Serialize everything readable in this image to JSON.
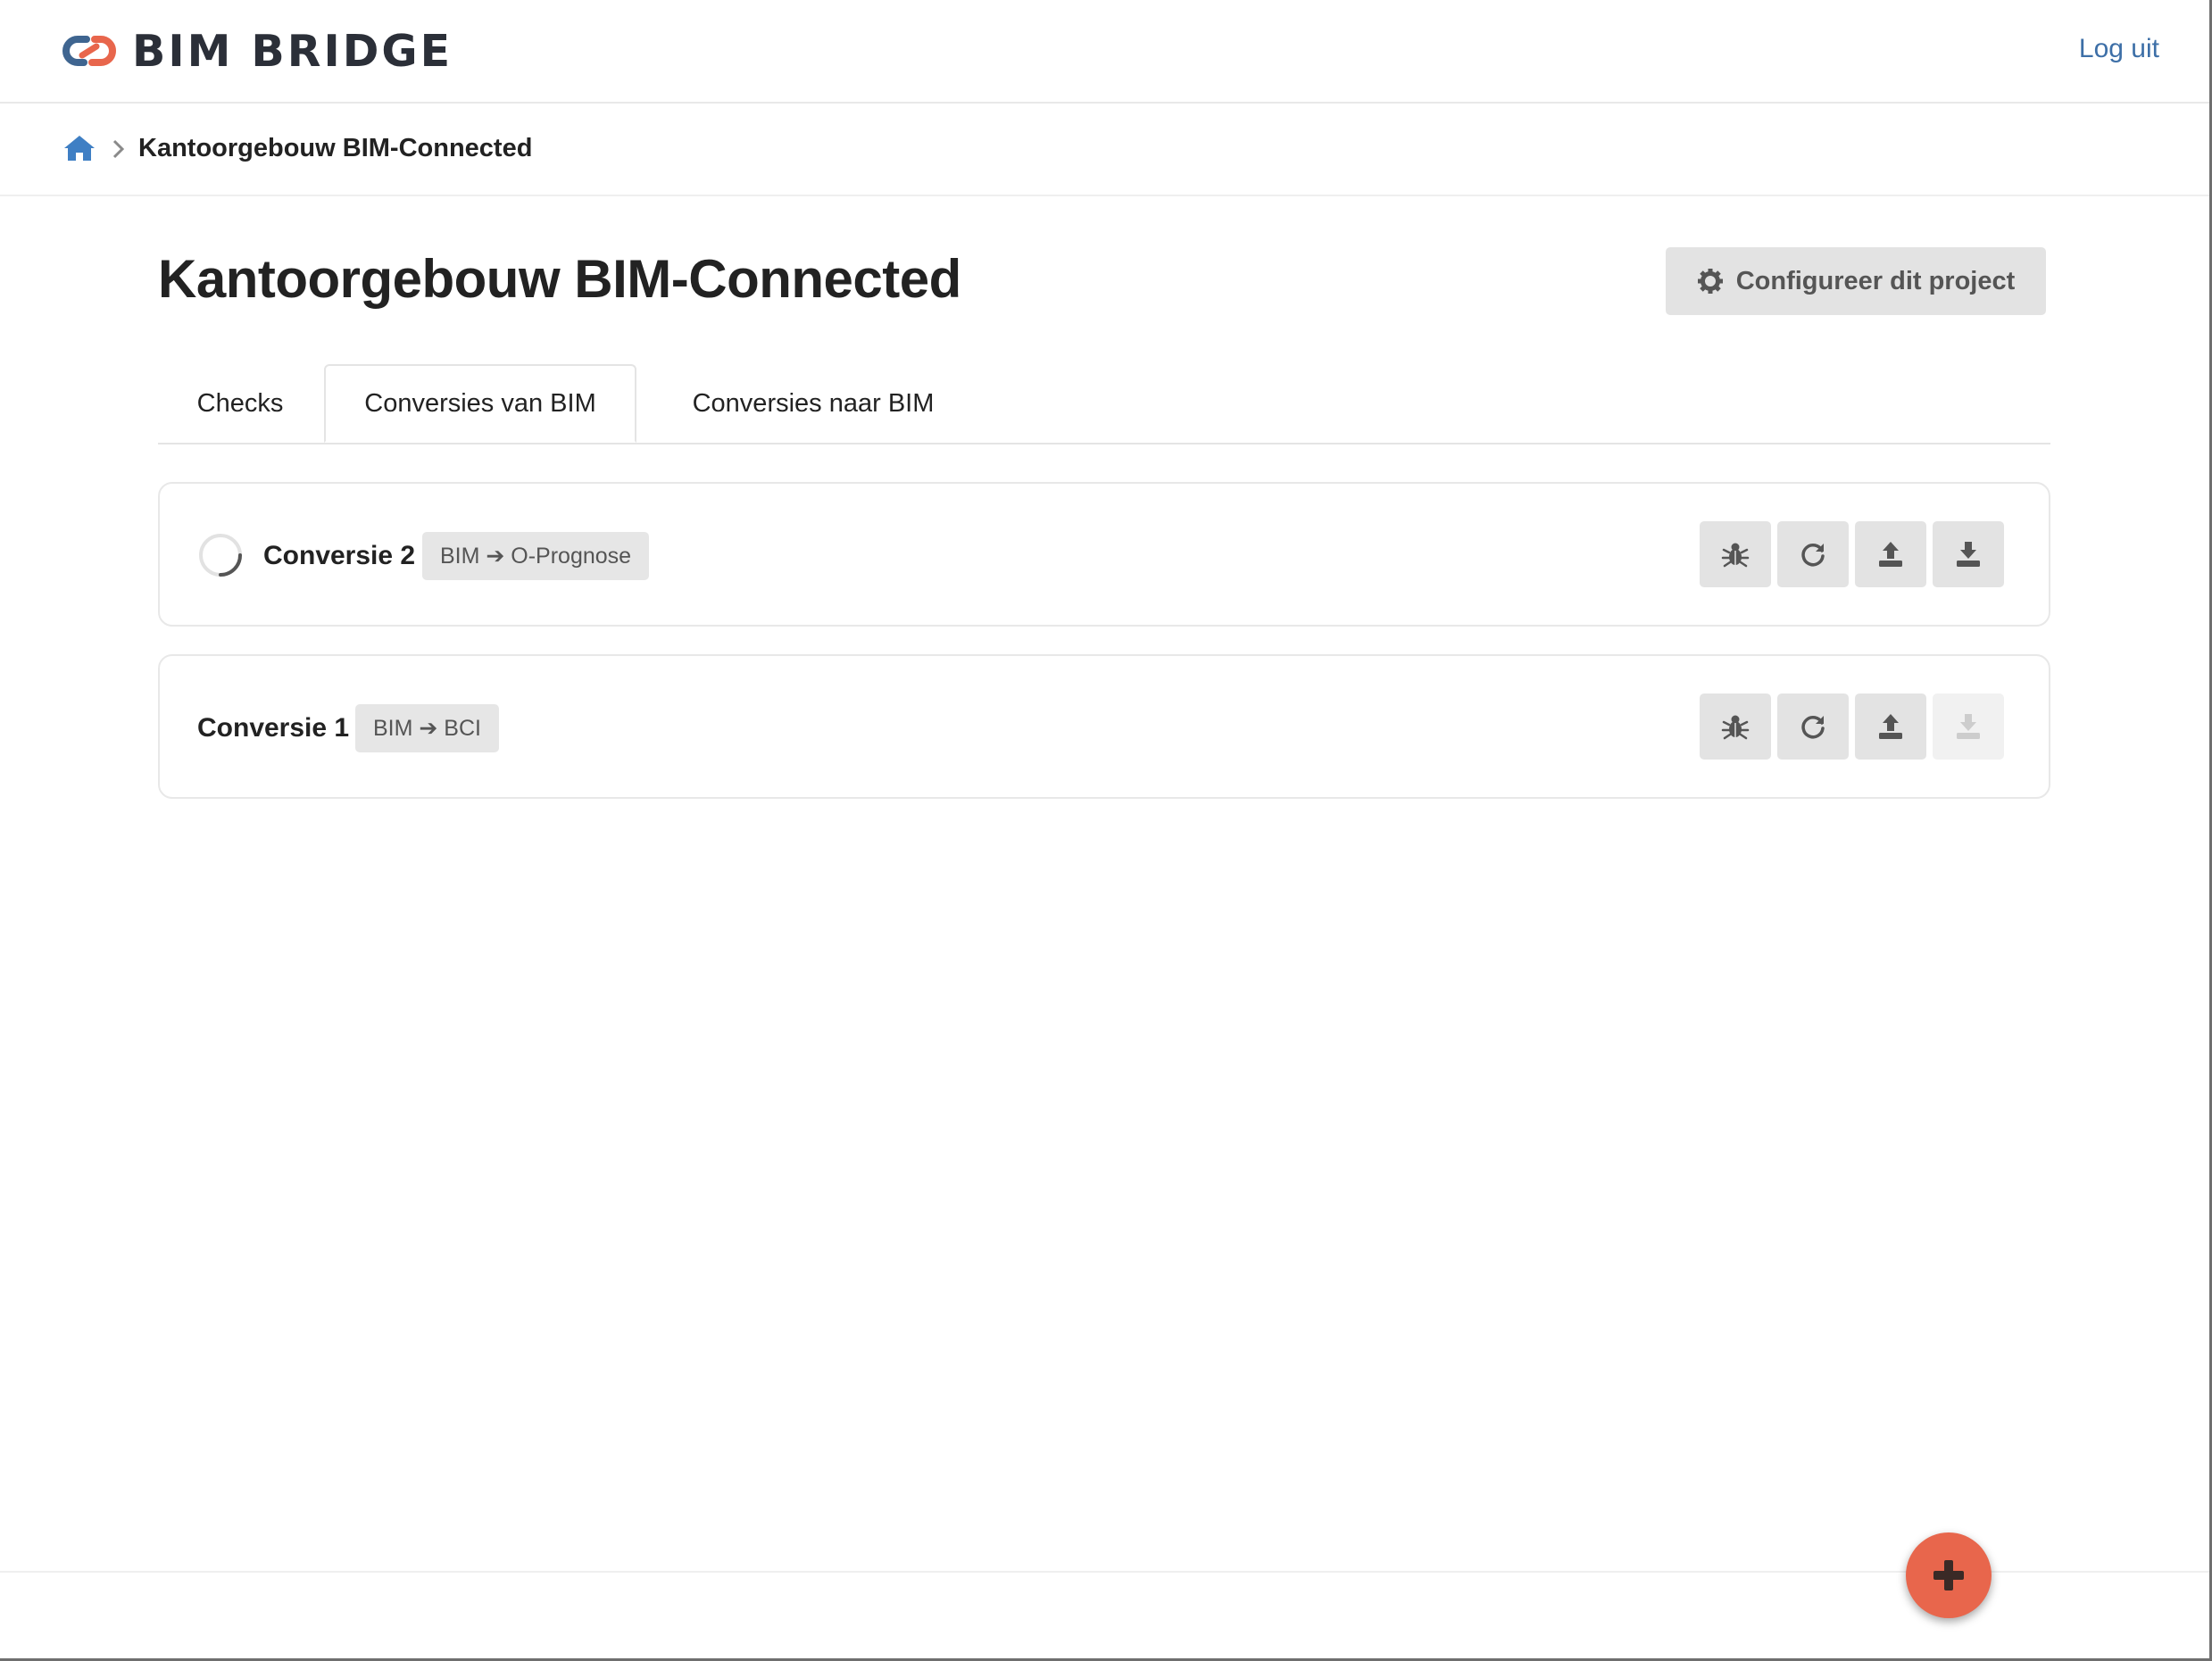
{
  "header": {
    "brand": "BIM BRIDGE",
    "logout_label": "Log uit"
  },
  "breadcrumb": {
    "home_icon": "home-icon",
    "current": "Kantoorgebouw BIM-Connected"
  },
  "page": {
    "title": "Kantoorgebouw BIM-Connected",
    "config_label": "Configureer dit project"
  },
  "tabs": [
    {
      "label": "Checks",
      "active": false
    },
    {
      "label": "Conversies van BIM",
      "active": true
    },
    {
      "label": "Conversies naar BIM",
      "active": false
    }
  ],
  "conversions": [
    {
      "name": "Conversie 2",
      "badge": "BIM ➔ O-Prognose",
      "status": "running",
      "actions": [
        "bug-icon",
        "refresh-icon",
        "upload-icon",
        "download-icon"
      ],
      "download_enabled": true
    },
    {
      "name": "Conversie 1",
      "badge": "BIM ➔ BCI",
      "status": "idle",
      "actions": [
        "bug-icon",
        "refresh-icon",
        "upload-icon",
        "download-icon"
      ],
      "download_enabled": false
    }
  ],
  "colors": {
    "accent": "#e8664c",
    "link": "#3d6fa7",
    "logo_blue": "#3f6590",
    "logo_orange": "#e8664c"
  }
}
